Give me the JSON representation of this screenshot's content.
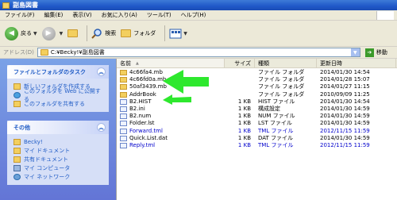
{
  "window": {
    "title": "副島図書"
  },
  "menu": [
    "ファイル(F)",
    "編集(E)",
    "表示(V)",
    "お気に入り(A)",
    "ツール(T)",
    "ヘルプ(H)"
  ],
  "toolbar": {
    "back": "戻る",
    "search": "検索",
    "folders": "フォルダ"
  },
  "address": {
    "label": "アドレス(D)",
    "path": "C:¥Becky!¥副島図書",
    "go": "移動"
  },
  "tasks_panel": {
    "title": "ファイルとフォルダのタスク",
    "items": [
      "新しいフォルダを作成する",
      "このフォルダを Web に公開する",
      "このフォルダを共有する"
    ]
  },
  "other_panel": {
    "title": "その他",
    "items": [
      "Becky!",
      "マイ ドキュメント",
      "共有ドキュメント",
      "マイ コンピュータ",
      "マイ ネットワーク"
    ]
  },
  "columns": {
    "name": "名前",
    "size": "サイズ",
    "type": "種類",
    "date": "更新日時"
  },
  "files": [
    {
      "name": "4c66fa4.mb",
      "size": "",
      "type": "ファイル フォルダ",
      "date": "2014/01/30 14:54",
      "kind": "folder",
      "blue": false
    },
    {
      "name": "4c66fd0a.mb",
      "size": "",
      "type": "ファイル フォルダ",
      "date": "2014/01/28 15:07",
      "kind": "folder",
      "blue": false
    },
    {
      "name": "50af3439.mb",
      "size": "",
      "type": "ファイル フォルダ",
      "date": "2014/01/27 11:15",
      "kind": "folder",
      "blue": false
    },
    {
      "name": "AddrBook",
      "size": "",
      "type": "ファイル フォルダ",
      "date": "2010/09/09 11:25",
      "kind": "folder",
      "blue": false
    },
    {
      "name": "B2.HIST",
      "size": "1 KB",
      "type": "HIST ファイル",
      "date": "2014/01/30 14:54",
      "kind": "file",
      "blue": false
    },
    {
      "name": "B2.ini",
      "size": "1 KB",
      "type": "構成設定",
      "date": "2014/01/30 14:59",
      "kind": "file",
      "blue": false
    },
    {
      "name": "B2.num",
      "size": "1 KB",
      "type": "NUM ファイル",
      "date": "2014/01/30 14:59",
      "kind": "file",
      "blue": false
    },
    {
      "name": "Folder.lst",
      "size": "1 KB",
      "type": "LST ファイル",
      "date": "2014/01/30 14:59",
      "kind": "file",
      "blue": false
    },
    {
      "name": "Forward.tml",
      "size": "1 KB",
      "type": "TML ファイル",
      "date": "2012/11/15 11:59",
      "kind": "file",
      "blue": true
    },
    {
      "name": "Quick.List.dat",
      "size": "1 KB",
      "type": "DAT ファイル",
      "date": "2014/01/30 14:59",
      "kind": "file",
      "blue": false
    },
    {
      "name": "Reply.tml",
      "size": "1 KB",
      "type": "TML ファイル",
      "date": "2012/11/15 11:59",
      "kind": "file",
      "blue": true
    }
  ],
  "colors": {
    "arrow": "#2ee82e",
    "link": "#215dc6",
    "title": "#2058c8"
  }
}
